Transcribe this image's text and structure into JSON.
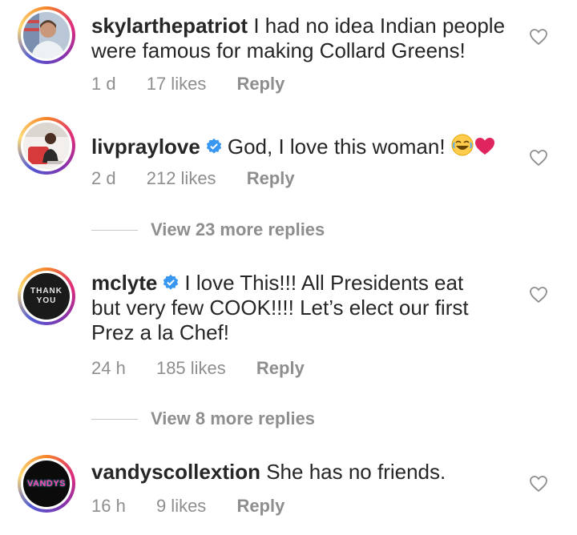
{
  "comments": [
    {
      "username": "skylarthepatriot",
      "verified": false,
      "text": "I had no idea Indian people were famous for making Collard Greens!",
      "time": "1 d",
      "likes": "17 likes",
      "reply": "Reply"
    },
    {
      "username": "livpraylove",
      "verified": true,
      "text": "God, I love this woman!",
      "time": "2 d",
      "likes": "212 likes",
      "reply": "Reply",
      "view_more": "View 23 more replies"
    },
    {
      "username": "mclyte",
      "verified": true,
      "text": "I love This!!! All Presidents eat but very few COOK!!!! Let’s elect our first Prez a la Chef!",
      "avatar_text": "THANK YOU",
      "time": "24 h",
      "likes": "185 likes",
      "reply": "Reply",
      "view_more": "View 8 more replies"
    },
    {
      "username": "vandyscollextion",
      "verified": false,
      "text": "She has no friends.",
      "avatar_text": "VANDYS",
      "time": "16 h",
      "likes": "9 likes",
      "reply": "Reply"
    }
  ],
  "colors": {
    "verified": "#3897f0",
    "meta_text": "#8e8e8e",
    "heart_emoji": "#e0245e"
  }
}
